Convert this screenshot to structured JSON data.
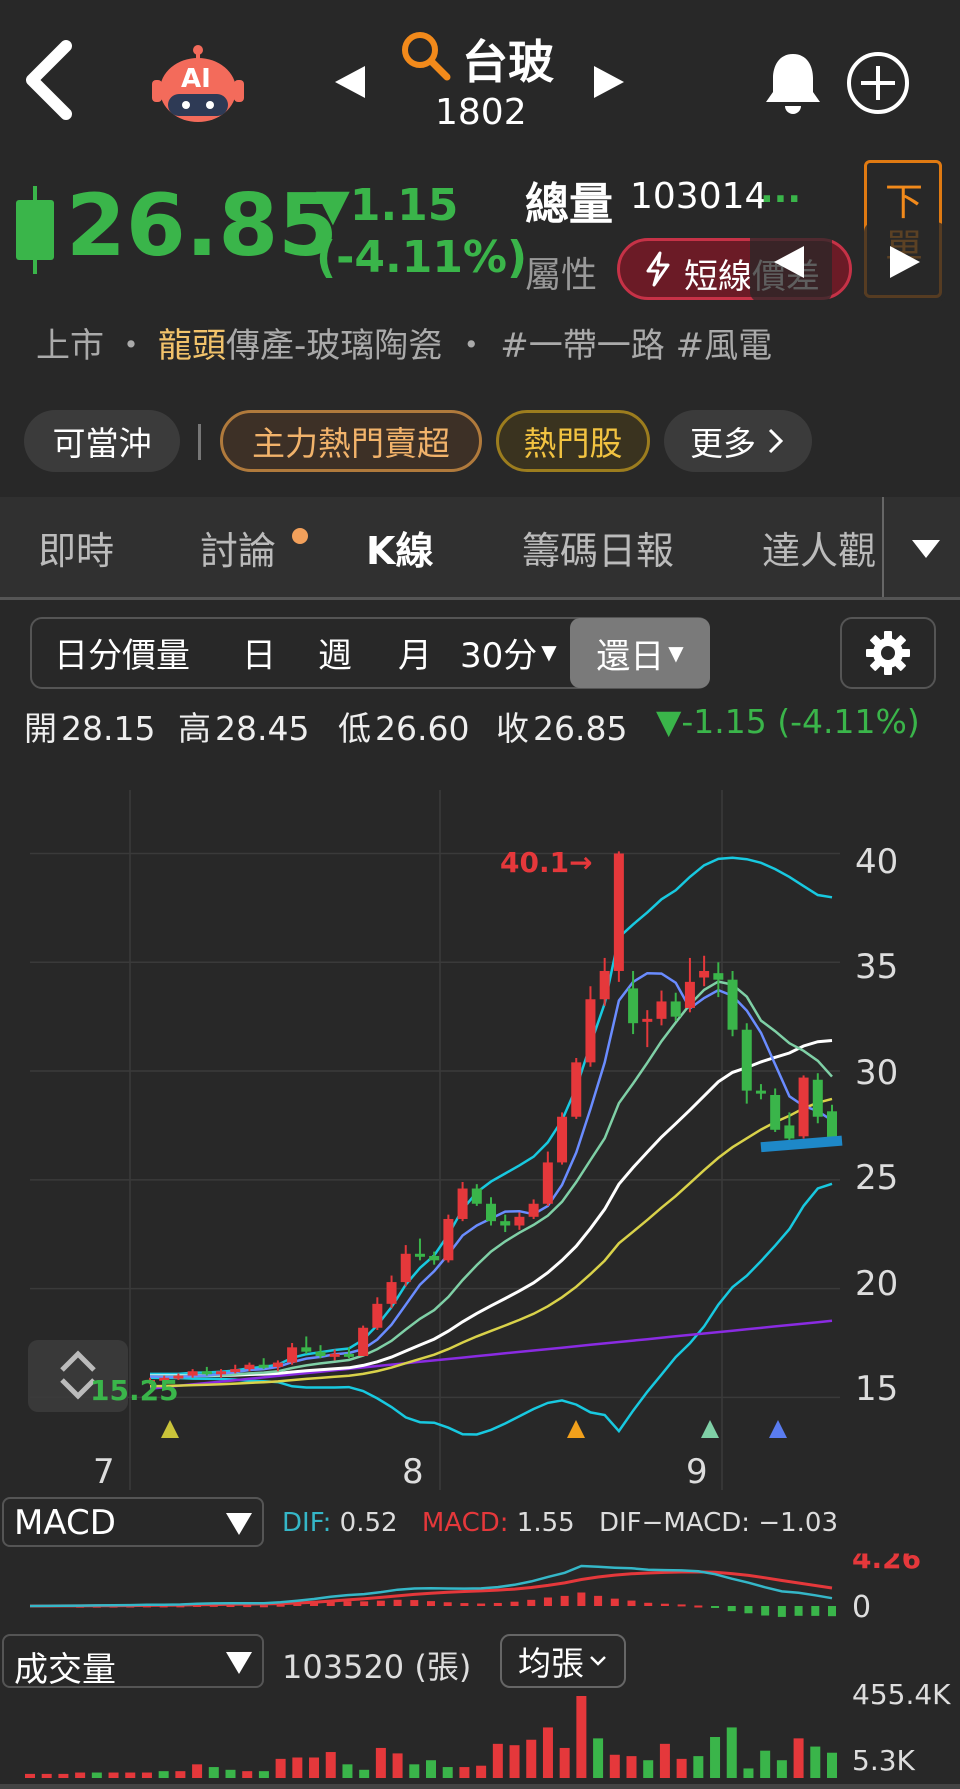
{
  "header": {
    "stock_name": "台玻",
    "stock_code": "1802",
    "ai_label": "AI"
  },
  "quote": {
    "price": "26.85",
    "change": "▼1.15",
    "change_pct": "(-4.11%)",
    "volume_label": "總量",
    "volume_value": "103014",
    "volume_more": "...",
    "attr_label": "屬性",
    "attr_value": "短線價差",
    "side_btn_label": "下單"
  },
  "tags": {
    "market": "上市",
    "sep": "・",
    "leader": "龍頭",
    "industry": "傳產-玻璃陶瓷",
    "sep2": "・",
    "hashtags": "#一帶一路  #風電"
  },
  "chips": [
    "可當沖",
    "主力熱門賣超",
    "熱門股",
    "更多"
  ],
  "tabs": [
    "即時",
    "討論",
    "K線",
    "籌碼日報",
    "達人觀"
  ],
  "periods": [
    "日分價量",
    "日",
    "週",
    "月",
    "30分",
    "還日"
  ],
  "ohlc": {
    "open_label": "開",
    "open": "28.15",
    "high_label": "高",
    "high": "28.45",
    "low_label": "低",
    "low": "26.60",
    "close_label": "收",
    "close": "26.85",
    "change": "▼-1.15 (-4.11%)"
  },
  "chart_data": {
    "type": "candlestick",
    "y_ticks": [
      "40",
      "35",
      "30",
      "25",
      "20",
      "15"
    ],
    "ylim": [
      13.5,
      42
    ],
    "x_ticks": [
      "7",
      "8",
      "9"
    ],
    "annotation_high": "40.1→",
    "annotation_low": "15.25",
    "colors": {
      "up": "#e5383b",
      "down": "#3ab54a",
      "ma5": "#6a8cff",
      "ma10": "#7fd0a6",
      "ma20": "#ffffff",
      "ma60": "#d9d24a",
      "ma240": "#8a2be2",
      "bb": "#18c9e0"
    },
    "candles": [
      [
        15.7,
        15.9,
        15.6,
        15.8
      ],
      [
        15.8,
        16.0,
        15.7,
        15.9
      ],
      [
        15.9,
        16.1,
        15.8,
        16.0
      ],
      [
        16.0,
        16.3,
        15.9,
        16.2
      ],
      [
        16.2,
        16.4,
        16.0,
        16.1
      ],
      [
        16.1,
        16.3,
        15.9,
        16.2
      ],
      [
        16.2,
        16.5,
        16.1,
        16.3
      ],
      [
        16.3,
        16.6,
        16.2,
        16.5
      ],
      [
        16.5,
        16.8,
        16.3,
        16.4
      ],
      [
        16.4,
        16.7,
        16.2,
        16.6
      ],
      [
        16.6,
        17.5,
        16.5,
        17.3
      ],
      [
        17.3,
        17.8,
        17.0,
        17.1
      ],
      [
        17.1,
        17.4,
        16.8,
        16.9
      ],
      [
        16.9,
        17.2,
        16.7,
        17.0
      ],
      [
        17.0,
        17.3,
        16.8,
        16.9
      ],
      [
        16.9,
        18.3,
        16.9,
        18.2
      ],
      [
        18.2,
        19.6,
        18.1,
        19.3
      ],
      [
        19.3,
        20.6,
        19.1,
        20.3
      ],
      [
        20.3,
        22.0,
        20.1,
        21.6
      ],
      [
        21.6,
        22.3,
        21.3,
        21.5
      ],
      [
        21.5,
        21.7,
        21.1,
        21.3
      ],
      [
        21.3,
        23.4,
        21.2,
        23.2
      ],
      [
        23.2,
        24.9,
        23.1,
        24.6
      ],
      [
        24.6,
        24.8,
        23.8,
        23.9
      ],
      [
        23.9,
        24.2,
        22.9,
        23.1
      ],
      [
        23.1,
        23.4,
        22.6,
        22.9
      ],
      [
        22.9,
        23.5,
        22.7,
        23.3
      ],
      [
        23.3,
        24.1,
        23.2,
        23.9
      ],
      [
        23.9,
        26.3,
        23.8,
        25.8
      ],
      [
        25.8,
        28.1,
        25.7,
        27.9
      ],
      [
        27.9,
        30.6,
        27.8,
        30.4
      ],
      [
        30.4,
        33.9,
        30.2,
        33.3
      ],
      [
        33.3,
        35.2,
        33.0,
        34.6
      ],
      [
        34.6,
        40.1,
        34.1,
        40.0
      ],
      [
        33.8,
        34.6,
        31.7,
        32.2
      ],
      [
        32.4,
        32.8,
        31.1,
        32.4
      ],
      [
        32.4,
        33.7,
        32.1,
        33.2
      ],
      [
        33.2,
        33.6,
        32.3,
        32.5
      ],
      [
        32.9,
        35.2,
        32.7,
        34.1
      ],
      [
        34.3,
        35.3,
        33.9,
        34.6
      ],
      [
        34.5,
        35.0,
        33.4,
        34.2
      ],
      [
        34.2,
        34.6,
        31.6,
        31.9
      ],
      [
        31.9,
        32.2,
        28.5,
        29.1
      ],
      [
        29.1,
        29.4,
        28.7,
        29.0
      ],
      [
        28.9,
        29.2,
        27.2,
        27.3
      ],
      [
        27.5,
        28.1,
        26.8,
        26.9
      ],
      [
        27.0,
        29.8,
        26.9,
        29.7
      ],
      [
        29.6,
        29.9,
        27.6,
        27.9
      ],
      [
        28.15,
        28.45,
        26.6,
        26.85
      ]
    ],
    "volume_ticks": [
      "455.4K",
      "5.3K"
    ],
    "macd_ticks": [
      "4.26",
      "0"
    ]
  },
  "macd": {
    "selector": "MACD",
    "dif_label": "DIF:",
    "dif": "0.52",
    "macd_label": "MACD:",
    "macd": "1.55",
    "osc_label": "DIF−MACD:",
    "osc": "−1.03"
  },
  "volume": {
    "selector": "成交量",
    "value": "103520 (張)",
    "avg_btn": "均張"
  }
}
